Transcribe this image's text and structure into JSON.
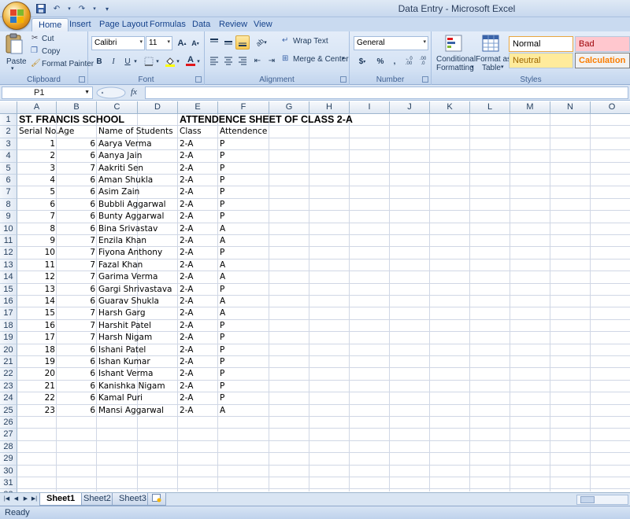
{
  "window": {
    "title": "Data Entry - Microsoft Excel"
  },
  "ribbon": {
    "tabs": [
      "Home",
      "Insert",
      "Page Layout",
      "Formulas",
      "Data",
      "Review",
      "View"
    ],
    "clipboard": {
      "label": "Clipboard",
      "paste": "Paste",
      "cut": "Cut",
      "copy": "Copy",
      "format_painter": "Format Painter"
    },
    "font": {
      "label": "Font",
      "name": "Calibri",
      "size": "11",
      "bold": "B",
      "italic": "I",
      "underline": "U",
      "grow": "A",
      "shrink": "A"
    },
    "alignment": {
      "label": "Alignment",
      "wrap_text": "Wrap Text",
      "merge_center": "Merge & Center"
    },
    "number": {
      "label": "Number",
      "format": "General",
      "currency": "$",
      "percent": "%",
      "comma": ",",
      "inc_decimal": ".00",
      "dec_decimal": ".0"
    },
    "styles": {
      "label": "Styles",
      "conditional": "Conditional",
      "formatting": "Formatting",
      "format_as": "Format as",
      "table": "Table",
      "normal": "Normal",
      "bad": "Bad",
      "neutral": "Neutral",
      "calculation": "Calculation"
    }
  },
  "formula_bar": {
    "name_box": "P1",
    "fx": "fx",
    "value": ""
  },
  "columns": [
    "A",
    "B",
    "C",
    "D",
    "E",
    "F",
    "G",
    "H",
    "I",
    "J",
    "K",
    "L",
    "M",
    "N",
    "O"
  ],
  "row_count": 32,
  "sheet": {
    "title_school": "ST. FRANCIS  SCHOOL",
    "title_sheet": "ATTENDENCE SHEET OF CLASS 2-A",
    "headers": {
      "serial": "Serial No.",
      "age": "Age",
      "name": "Name of Students",
      "class": "Class",
      "attendence": "Attendence"
    },
    "rows": [
      {
        "serial": "1",
        "age": "6",
        "name": "Aarya Verma",
        "class": "2-A",
        "att": "P"
      },
      {
        "serial": "2",
        "age": "6",
        "name": "Aanya Jain",
        "class": "2-A",
        "att": "P"
      },
      {
        "serial": "3",
        "age": "7",
        "name": "Aakriti Sen",
        "class": "2-A",
        "att": "P"
      },
      {
        "serial": "4",
        "age": "6",
        "name": "Aman Shukla",
        "class": "2-A",
        "att": "P"
      },
      {
        "serial": "5",
        "age": "6",
        "name": "Asim Zain",
        "class": "2-A",
        "att": "P"
      },
      {
        "serial": "6",
        "age": "6",
        "name": "Bubbli Aggarwal",
        "class": "2-A",
        "att": "P"
      },
      {
        "serial": "7",
        "age": "6",
        "name": "Bunty Aggarwal",
        "class": "2-A",
        "att": "P"
      },
      {
        "serial": "8",
        "age": "6",
        "name": "Bina Srivastav",
        "class": "2-A",
        "att": "A"
      },
      {
        "serial": "9",
        "age": "7",
        "name": "Enzila Khan",
        "class": "2-A",
        "att": "A"
      },
      {
        "serial": "10",
        "age": "7",
        "name": "Fiyona Anthony",
        "class": "2-A",
        "att": "P"
      },
      {
        "serial": "11",
        "age": "7",
        "name": "Fazal Khan",
        "class": "2-A",
        "att": "A"
      },
      {
        "serial": "12",
        "age": "7",
        "name": "Garima Verma",
        "class": "2-A",
        "att": "A"
      },
      {
        "serial": "13",
        "age": "6",
        "name": "Gargi Shrivastava",
        "class": "2-A",
        "att": "P"
      },
      {
        "serial": "14",
        "age": "6",
        "name": "Guarav Shukla",
        "class": "2-A",
        "att": "A"
      },
      {
        "serial": "15",
        "age": "7",
        "name": "Harsh Garg",
        "class": "2-A",
        "att": "A"
      },
      {
        "serial": "16",
        "age": "7",
        "name": "Harshit Patel",
        "class": "2-A",
        "att": "P"
      },
      {
        "serial": "17",
        "age": "7",
        "name": "Harsh Nigam",
        "class": "2-A",
        "att": "P"
      },
      {
        "serial": "18",
        "age": "6",
        "name": "Ishani Patel",
        "class": "2-A",
        "att": "P"
      },
      {
        "serial": "19",
        "age": "6",
        "name": "Ishan Kumar",
        "class": "2-A",
        "att": "P"
      },
      {
        "serial": "20",
        "age": "6",
        "name": "Ishant Verma",
        "class": "2-A",
        "att": "P"
      },
      {
        "serial": "21",
        "age": "6",
        "name": "Kanishka Nigam",
        "class": "2-A",
        "att": "P"
      },
      {
        "serial": "22",
        "age": "6",
        "name": "Kamal Puri",
        "class": "2-A",
        "att": "P"
      },
      {
        "serial": "23",
        "age": "6",
        "name": "Mansi Aggarwal",
        "class": "2-A",
        "att": "A"
      }
    ]
  },
  "sheet_tabs": [
    "Sheet1",
    "Sheet2",
    "Sheet3"
  ],
  "status": {
    "text": "Ready"
  },
  "colors": {
    "accent": "#15428b",
    "ribbon": "#d4e2f4",
    "grid_line": "#d0d7e5"
  }
}
